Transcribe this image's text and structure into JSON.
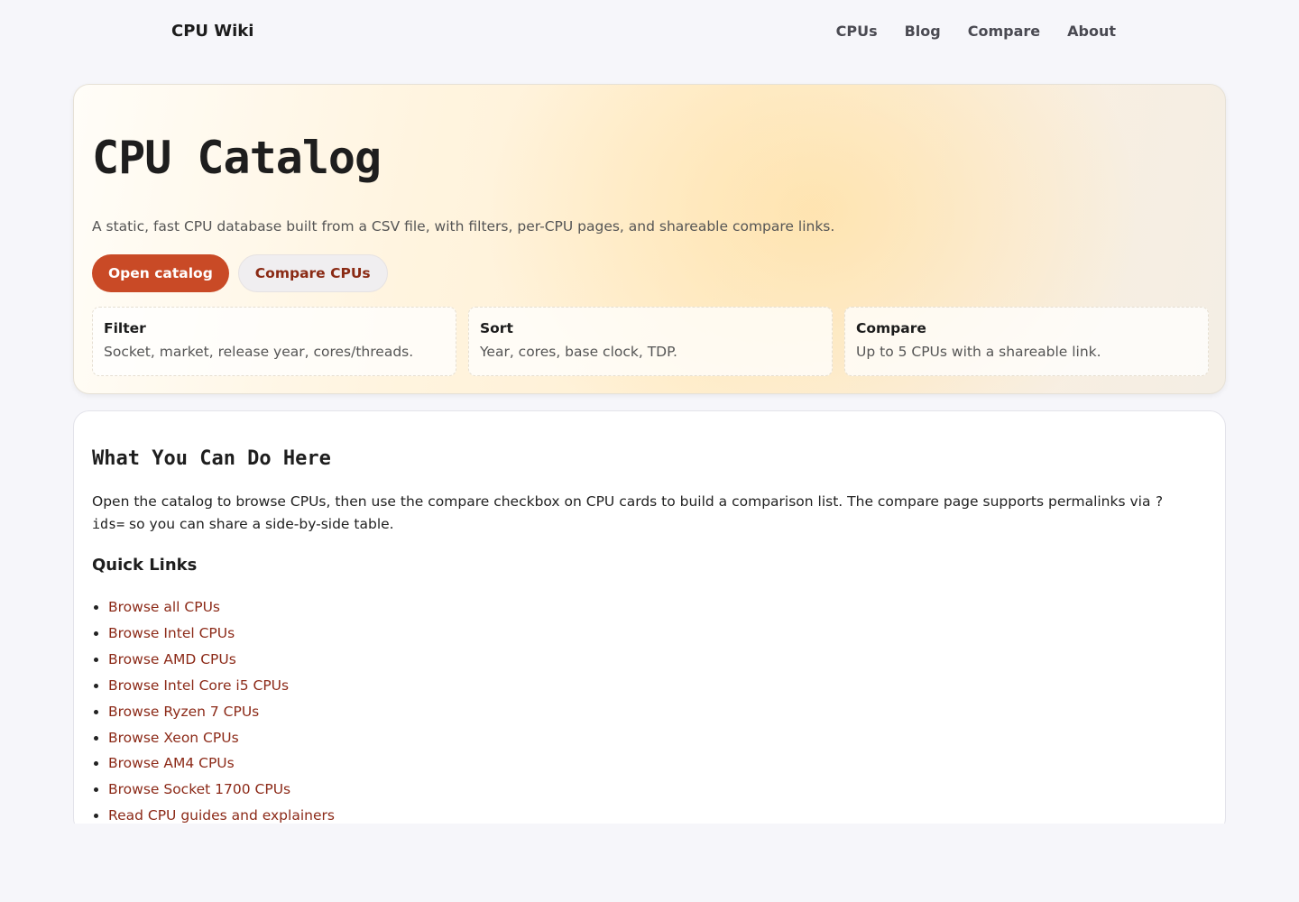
{
  "header": {
    "brand": "CPU Wiki",
    "nav": [
      "CPUs",
      "Blog",
      "Compare",
      "About"
    ]
  },
  "hero": {
    "title": "CPU Catalog",
    "subtitle": "A static, fast CPU database built from a CSV file, with filters, per-CPU pages, and shareable compare links.",
    "primary_button": "Open catalog",
    "secondary_button": "Compare CPUs",
    "features": [
      {
        "title": "Filter",
        "desc": "Socket, market, release year, cores/threads."
      },
      {
        "title": "Sort",
        "desc": "Year, cores, base clock, TDP."
      },
      {
        "title": "Compare",
        "desc": "Up to 5 CPUs with a shareable link."
      }
    ]
  },
  "about": {
    "title": "What You Can Do Here",
    "body_before": "Open the catalog to browse CPUs, then use the compare checkbox on CPU cards to build a comparison list. The compare page supports permalinks via ",
    "body_code": "?ids=",
    "body_after": " so you can share a side-by-side table.",
    "quick_links_title": "Quick Links",
    "quick_links": [
      "Browse all CPUs",
      "Browse Intel CPUs",
      "Browse AMD CPUs",
      "Browse Intel Core i5 CPUs",
      "Browse Ryzen 7 CPUs",
      "Browse Xeon CPUs",
      "Browse AM4 CPUs",
      "Browse Socket 1700 CPUs",
      "Read CPU guides and explainers"
    ]
  },
  "colors": {
    "accent": "#c94a26",
    "link": "#8c2a18",
    "background": "#f6f6fa"
  }
}
